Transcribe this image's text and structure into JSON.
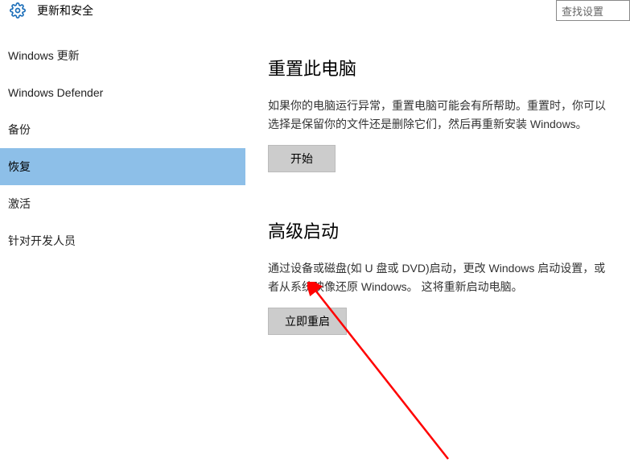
{
  "header": {
    "title": "更新和安全",
    "search_placeholder": "查找设置"
  },
  "sidebar": {
    "items": [
      {
        "label": "Windows 更新"
      },
      {
        "label": "Windows Defender"
      },
      {
        "label": "备份"
      },
      {
        "label": "恢复"
      },
      {
        "label": "激活"
      },
      {
        "label": "针对开发人员"
      }
    ],
    "active_index": 3
  },
  "content": {
    "reset": {
      "title": "重置此电脑",
      "desc": "如果你的电脑运行异常，重置电脑可能会有所帮助。重置时，你可以选择是保留你的文件还是删除它们，然后再重新安装 Windows。",
      "button": "开始"
    },
    "advanced": {
      "title": "高级启动",
      "desc": "通过设备或磁盘(如 U 盘或 DVD)启动，更改 Windows 启动设置，或者从系统映像还原 Windows。 这将重新启动电脑。",
      "button": "立即重启"
    }
  },
  "annotation": {
    "arrow_color": "#ff0000"
  }
}
